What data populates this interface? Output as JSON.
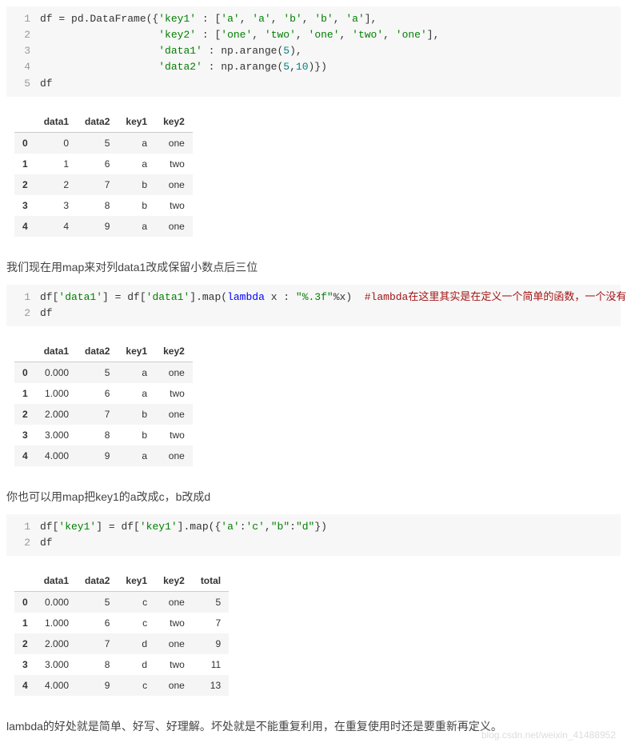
{
  "code1": {
    "lines": [
      {
        "n": "1",
        "segs": [
          {
            "t": "df ",
            "c": "tok-black"
          },
          {
            "t": "=",
            "c": "tok-black"
          },
          {
            "t": " pd.DataFrame({",
            "c": "tok-black"
          },
          {
            "t": "'key1'",
            "c": "tok-green"
          },
          {
            "t": " : [",
            "c": "tok-black"
          },
          {
            "t": "'a'",
            "c": "tok-green"
          },
          {
            "t": ", ",
            "c": "tok-black"
          },
          {
            "t": "'a'",
            "c": "tok-green"
          },
          {
            "t": ", ",
            "c": "tok-black"
          },
          {
            "t": "'b'",
            "c": "tok-green"
          },
          {
            "t": ", ",
            "c": "tok-black"
          },
          {
            "t": "'b'",
            "c": "tok-green"
          },
          {
            "t": ", ",
            "c": "tok-black"
          },
          {
            "t": "'a'",
            "c": "tok-green"
          },
          {
            "t": "],",
            "c": "tok-black"
          }
        ]
      },
      {
        "n": "2",
        "segs": [
          {
            "t": "                   ",
            "c": "tok-black"
          },
          {
            "t": "'key2'",
            "c": "tok-green"
          },
          {
            "t": " : [",
            "c": "tok-black"
          },
          {
            "t": "'one'",
            "c": "tok-green"
          },
          {
            "t": ", ",
            "c": "tok-black"
          },
          {
            "t": "'two'",
            "c": "tok-green"
          },
          {
            "t": ", ",
            "c": "tok-black"
          },
          {
            "t": "'one'",
            "c": "tok-green"
          },
          {
            "t": ", ",
            "c": "tok-black"
          },
          {
            "t": "'two'",
            "c": "tok-green"
          },
          {
            "t": ", ",
            "c": "tok-black"
          },
          {
            "t": "'one'",
            "c": "tok-green"
          },
          {
            "t": "],",
            "c": "tok-black"
          }
        ]
      },
      {
        "n": "3",
        "segs": [
          {
            "t": "                   ",
            "c": "tok-black"
          },
          {
            "t": "'data1'",
            "c": "tok-green"
          },
          {
            "t": " : np.arange(",
            "c": "tok-black"
          },
          {
            "t": "5",
            "c": "tok-teal"
          },
          {
            "t": "),",
            "c": "tok-black"
          }
        ]
      },
      {
        "n": "4",
        "segs": [
          {
            "t": "                   ",
            "c": "tok-black"
          },
          {
            "t": "'data2'",
            "c": "tok-green"
          },
          {
            "t": " : np.arange(",
            "c": "tok-black"
          },
          {
            "t": "5",
            "c": "tok-teal"
          },
          {
            "t": ",",
            "c": "tok-black"
          },
          {
            "t": "10",
            "c": "tok-teal"
          },
          {
            "t": ")})",
            "c": "tok-black"
          }
        ]
      },
      {
        "n": "5",
        "segs": [
          {
            "t": "df",
            "c": "tok-black"
          }
        ]
      }
    ]
  },
  "table1": {
    "headers": [
      "data1",
      "data2",
      "key1",
      "key2"
    ],
    "index": [
      "0",
      "1",
      "2",
      "3",
      "4"
    ],
    "rows": [
      [
        "0",
        "5",
        "a",
        "one"
      ],
      [
        "1",
        "6",
        "a",
        "two"
      ],
      [
        "2",
        "7",
        "b",
        "one"
      ],
      [
        "3",
        "8",
        "b",
        "two"
      ],
      [
        "4",
        "9",
        "a",
        "one"
      ]
    ]
  },
  "para1": "我们现在用map来对列data1改成保留小数点后三位",
  "code2": {
    "lines": [
      {
        "n": "1",
        "segs": [
          {
            "t": "df[",
            "c": "tok-black"
          },
          {
            "t": "'data1'",
            "c": "tok-green"
          },
          {
            "t": "] ",
            "c": "tok-black"
          },
          {
            "t": "=",
            "c": "tok-black"
          },
          {
            "t": " df[",
            "c": "tok-black"
          },
          {
            "t": "'data1'",
            "c": "tok-green"
          },
          {
            "t": "].map(",
            "c": "tok-black"
          },
          {
            "t": "lambda",
            "c": "tok-blue"
          },
          {
            "t": " x : ",
            "c": "tok-black"
          },
          {
            "t": "\"%.3f\"",
            "c": "tok-green"
          },
          {
            "t": "%x)  ",
            "c": "tok-black"
          },
          {
            "t": "#lambda在这里其实是在定义一个简单的函数，一个没有函数名的函数。",
            "c": "tok-red"
          }
        ]
      },
      {
        "n": "2",
        "segs": [
          {
            "t": "df",
            "c": "tok-black"
          }
        ]
      }
    ]
  },
  "table2": {
    "headers": [
      "data1",
      "data2",
      "key1",
      "key2"
    ],
    "index": [
      "0",
      "1",
      "2",
      "3",
      "4"
    ],
    "rows": [
      [
        "0.000",
        "5",
        "a",
        "one"
      ],
      [
        "1.000",
        "6",
        "a",
        "two"
      ],
      [
        "2.000",
        "7",
        "b",
        "one"
      ],
      [
        "3.000",
        "8",
        "b",
        "two"
      ],
      [
        "4.000",
        "9",
        "a",
        "one"
      ]
    ]
  },
  "para2": "你也可以用map把key1的a改成c，b改成d",
  "code3": {
    "lines": [
      {
        "n": "1",
        "segs": [
          {
            "t": "df[",
            "c": "tok-black"
          },
          {
            "t": "'key1'",
            "c": "tok-green"
          },
          {
            "t": "] ",
            "c": "tok-black"
          },
          {
            "t": "=",
            "c": "tok-black"
          },
          {
            "t": " df[",
            "c": "tok-black"
          },
          {
            "t": "'key1'",
            "c": "tok-green"
          },
          {
            "t": "].map({",
            "c": "tok-black"
          },
          {
            "t": "'a'",
            "c": "tok-green"
          },
          {
            "t": ":",
            "c": "tok-black"
          },
          {
            "t": "'c'",
            "c": "tok-green"
          },
          {
            "t": ",",
            "c": "tok-black"
          },
          {
            "t": "\"b\"",
            "c": "tok-green"
          },
          {
            "t": ":",
            "c": "tok-black"
          },
          {
            "t": "\"d\"",
            "c": "tok-green"
          },
          {
            "t": "})",
            "c": "tok-black"
          }
        ]
      },
      {
        "n": "2",
        "segs": [
          {
            "t": "df",
            "c": "tok-black"
          }
        ]
      }
    ]
  },
  "table3": {
    "headers": [
      "data1",
      "data2",
      "key1",
      "key2",
      "total"
    ],
    "index": [
      "0",
      "1",
      "2",
      "3",
      "4"
    ],
    "rows": [
      [
        "0.000",
        "5",
        "c",
        "one",
        "5"
      ],
      [
        "1.000",
        "6",
        "c",
        "two",
        "7"
      ],
      [
        "2.000",
        "7",
        "d",
        "one",
        "9"
      ],
      [
        "3.000",
        "8",
        "d",
        "two",
        "11"
      ],
      [
        "4.000",
        "9",
        "c",
        "one",
        "13"
      ]
    ]
  },
  "para3": "lambda的好处就是简单、好写、好理解。坏处就是不能重复利用，在重复使用时还是要重新再定义。",
  "watermark": "blog.csdn.net/weixin_41488952"
}
